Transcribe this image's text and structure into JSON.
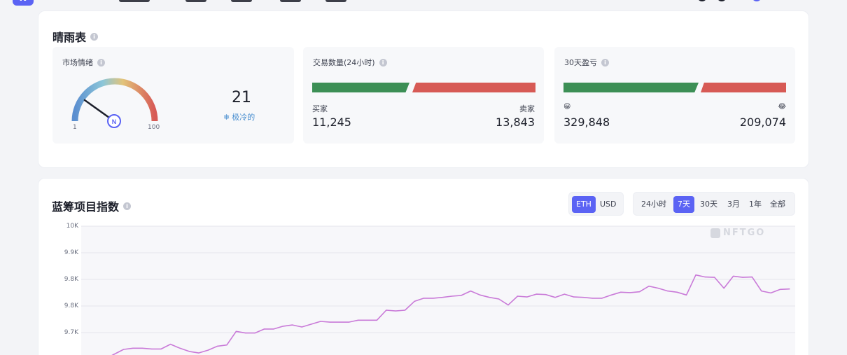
{
  "weather": {
    "title": "晴雨表",
    "sentiment": {
      "title": "市场情绪",
      "value": "21",
      "label": "极冷的",
      "min": "1",
      "max": "100"
    },
    "trades": {
      "title": "交易数量(24小时)",
      "buyer_label": "买家",
      "seller_label": "卖家",
      "buyers": "11,245",
      "sellers": "13,843"
    },
    "pnl": {
      "title": "30天盈亏",
      "profit_emoji": "😀",
      "loss_emoji": "😂",
      "profit": "329,848",
      "loss": "209,074"
    }
  },
  "bluechip": {
    "title": "蓝筹项目指数",
    "currency_options": [
      "ETH",
      "USD"
    ],
    "currency_selected": "ETH",
    "range_options": [
      "24小时",
      "7天",
      "30天",
      "3月",
      "1年",
      "全部"
    ],
    "range_selected": "7天",
    "watermark": "NFTGO"
  },
  "colors": {
    "accent": "#5b63f4",
    "buy_green": "#3c8f55",
    "sell_red": "#d75a55",
    "line": "#c97ad8"
  },
  "chart_data": {
    "type": "line",
    "title": "",
    "xlabel": "",
    "ylabel": "",
    "ylim": [
      9650,
      10000
    ],
    "ytick_labels": [
      "10K",
      "9.9K",
      "9.8K",
      "9.8K",
      "9.7K"
    ],
    "series": [
      {
        "values": [
          9663,
          9668,
          9668,
          9680,
          9692,
          9695,
          9695,
          9693,
          9693,
          9705,
          9695,
          9687,
          9683,
          9690,
          9700,
          9703,
          9737,
          9733,
          9733,
          9743,
          9743,
          9750,
          9753,
          9748,
          9755,
          9762,
          9760,
          9760,
          9760,
          9765,
          9765,
          9765,
          9790,
          9788,
          9790,
          9812,
          9820,
          9820,
          9822,
          9825,
          9827,
          9838,
          9828,
          9822,
          9818,
          9803,
          9825,
          9823,
          9830,
          9829,
          9822,
          9830,
          9823,
          9822,
          9820,
          9820,
          9828,
          9835,
          9834,
          9836,
          9850,
          9845,
          9838,
          9835,
          9828,
          9878,
          9873,
          9872,
          9845,
          9875,
          9872,
          9873,
          9838,
          9833,
          9842,
          9843
        ]
      }
    ]
  }
}
